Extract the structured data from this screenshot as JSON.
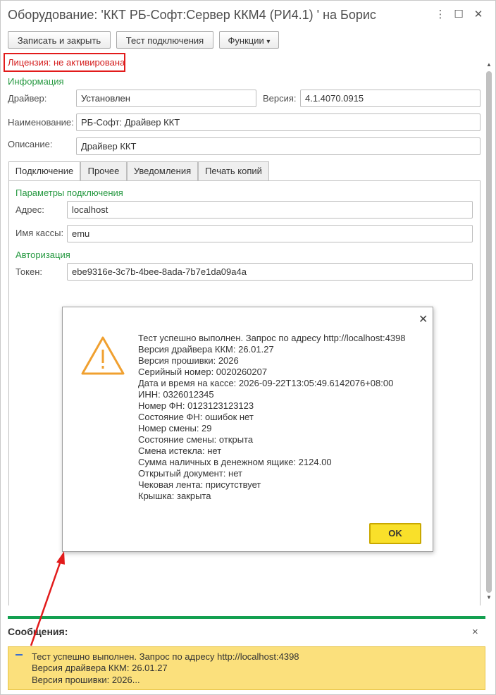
{
  "window": {
    "title": "Оборудование: 'ККТ РБ-Софт:Сервер ККМ4 (РИ4.1) ' на Борис",
    "controls": {
      "minimize": "⋮",
      "maximize": "☐",
      "close": "✕"
    }
  },
  "toolbar": {
    "save_close": "Записать и закрыть",
    "test_connection": "Тест подключения",
    "functions": "Функции",
    "functions_arrow": "▾"
  },
  "license": "Лицензия: не активирована",
  "info": {
    "group_title": "Информация",
    "driver_label": "Драйвер:",
    "driver_value": "Установлен",
    "version_label": "Версия:",
    "version_value": "4.1.4070.0915",
    "name_label": "Наименование:",
    "name_value": "РБ-Софт: Драйвер ККТ",
    "description_label": "Описание:",
    "description_value": "Драйвер ККТ"
  },
  "tabs": [
    {
      "label": "Подключение",
      "active": true
    },
    {
      "label": "Прочее",
      "active": false
    },
    {
      "label": "Уведомления",
      "active": false
    },
    {
      "label": "Печать копий",
      "active": false
    }
  ],
  "connection": {
    "group_title": "Параметры подключения",
    "address_label": "Адрес:",
    "address_value": "localhost",
    "cashbox_label": "Имя кассы:",
    "cashbox_value": "emu",
    "auth_title": "Авторизация",
    "token_label": "Токен:",
    "token_value": "ebe9316e-3c7b-4bee-8ada-7b7e1da09a4a"
  },
  "dialog": {
    "close": "✕",
    "lines": [
      "Тест успешно выполнен. Запрос по адресу http://localhost:4398",
      "Версия драйвера ККМ: 26.01.27",
      "Версия прошивки: 2026",
      "Серийный номер: 0020260207",
      "Дата и время на кассе: 2026-09-22T13:05:49.6142076+08:00",
      "ИНН: 0326012345",
      "Номер ФН: 0123123123123",
      "Состояние ФН: ошибок нет",
      "Номер смены: 29",
      "Состояние смены: открыта",
      "Смена истекла: нет",
      "Сумма наличных в денежном ящике: 2124.00",
      "Открытый документ: нет",
      "Чековая лента: присутствует",
      "Крышка: закрыта"
    ],
    "ok_label": "OK",
    "icon": "warning-triangle-icon"
  },
  "messages": {
    "title": "Сообщения:",
    "close": "×",
    "lines": [
      "Тест успешно выполнен. Запрос по адресу http://localhost:4398",
      "Версия драйвера ККМ: 26.01.27",
      "Версия прошивки: 2026..."
    ]
  },
  "colors": {
    "license_red": "#e21b1b",
    "group_green": "#269941",
    "separator_green": "#13a050",
    "warning_orange": "#f0a030",
    "ok_yellow": "#f9e02a",
    "messages_yellow": "#fbe07c"
  }
}
